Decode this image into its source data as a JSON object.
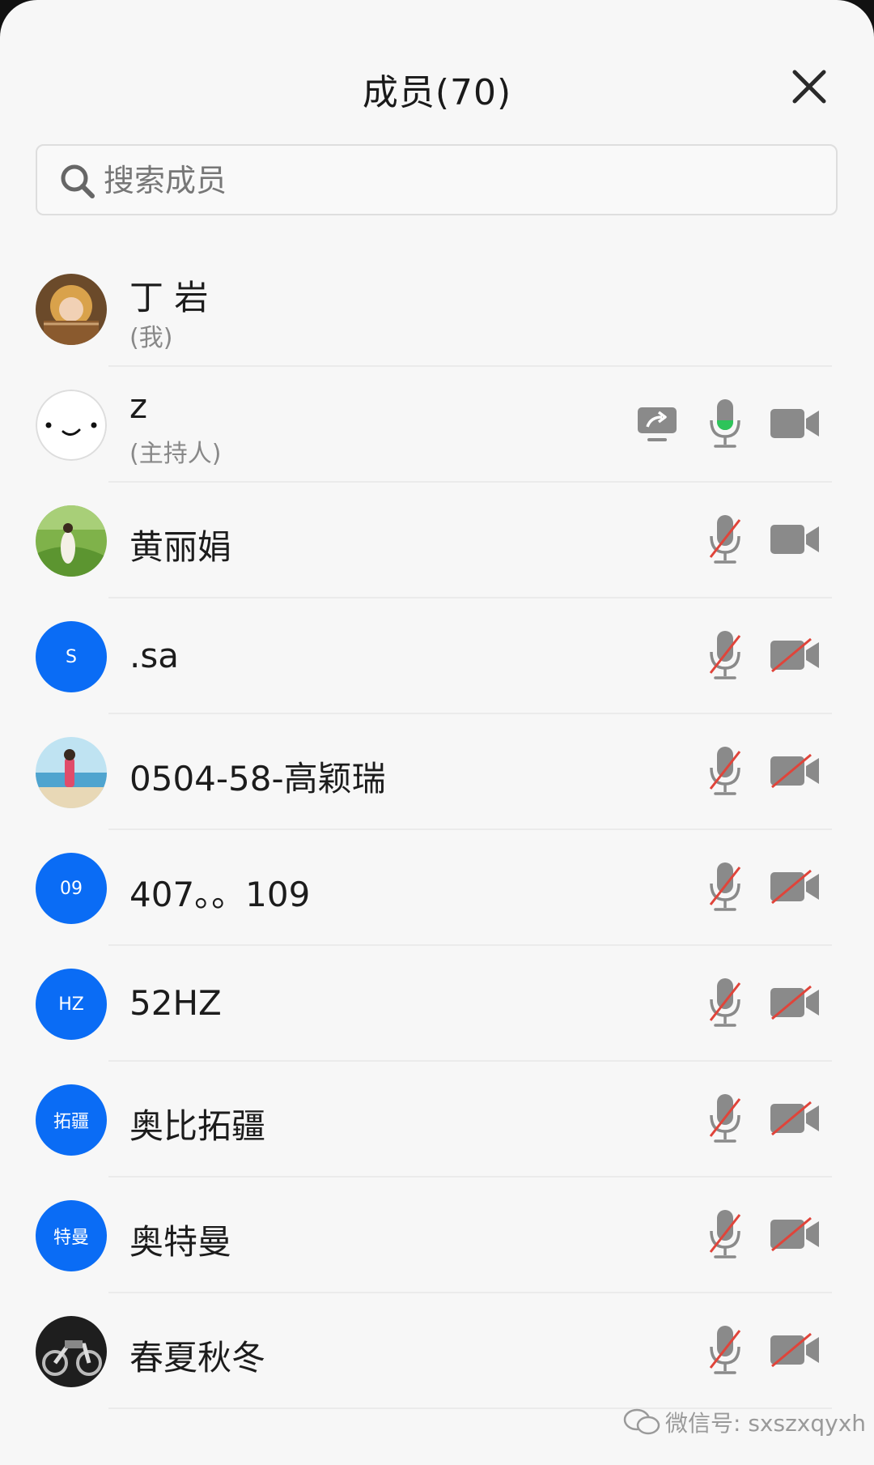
{
  "header": {
    "title": "成员(70)"
  },
  "search": {
    "placeholder": "搜索成员"
  },
  "members": [
    {
      "name": "丁 岩",
      "role": "(我)",
      "avatar": "photo-baby",
      "share": false,
      "mic": "none",
      "cam": "none"
    },
    {
      "name": "z",
      "role": "(主持人)",
      "avatar": "smiley",
      "share": true,
      "mic": "speaking",
      "cam": "on"
    },
    {
      "name": "黄丽娟",
      "avatar": "photo-field",
      "share": false,
      "mic": "muted",
      "cam": "on"
    },
    {
      "name": ".sa",
      "avatar_text": "S",
      "avatar": "initial",
      "share": false,
      "mic": "muted",
      "cam": "off"
    },
    {
      "name": "0504-58-高颖瑞",
      "avatar": "photo-beach",
      "share": false,
      "mic": "muted",
      "cam": "off"
    },
    {
      "name": "407。。109",
      "avatar_text": "09",
      "avatar": "initial",
      "share": false,
      "mic": "muted",
      "cam": "off"
    },
    {
      "name": "52HZ",
      "avatar_text": "HZ",
      "avatar": "initial",
      "share": false,
      "mic": "muted",
      "cam": "off"
    },
    {
      "name": "奥比拓疆",
      "avatar_text": "拓疆",
      "avatar": "initial",
      "share": false,
      "mic": "muted",
      "cam": "off"
    },
    {
      "name": "奥特曼",
      "avatar_text": "特曼",
      "avatar": "initial",
      "share": false,
      "mic": "muted",
      "cam": "off"
    },
    {
      "name": "春夏秋冬",
      "avatar": "photo-motorcycle",
      "share": false,
      "mic": "muted",
      "cam": "off"
    }
  ],
  "icons": {
    "close": "close-icon",
    "search": "search-icon",
    "share": "screen-share-icon",
    "mic": "microphone-icon",
    "cam": "video-camera-icon"
  },
  "colors": {
    "accent_blue": "#0a6cf5",
    "speaking_green": "#2ec45a",
    "muted_red": "#e0443a",
    "icon_gray": "#8a8a8a"
  },
  "watermark": {
    "text": "微信号: sxszxqyxh"
  }
}
